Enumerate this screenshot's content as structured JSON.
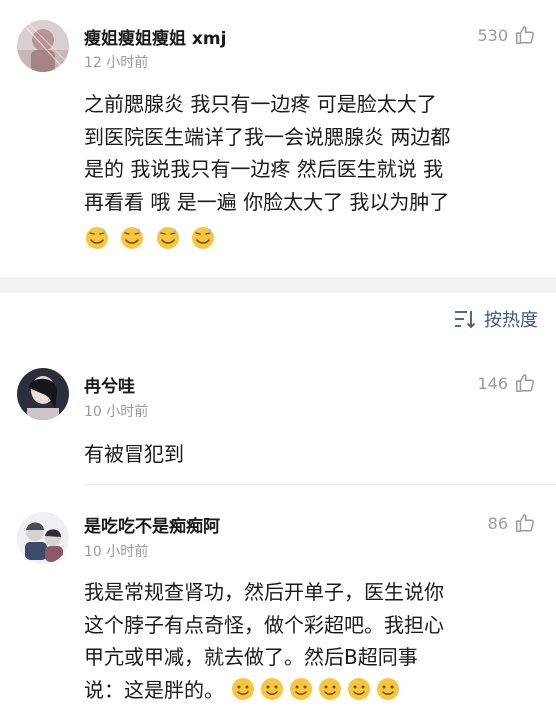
{
  "comments": [
    {
      "username": "瘦姐瘦姐瘦姐 xmj",
      "time": "12 小时前",
      "likes": "530",
      "lines": [
        "之前腮腺炎 我只有一边疼 可是脸太大了",
        "到医院医生端详了我一会说腮腺炎 两边都",
        "是的 我说我只有一边疼 然后医生就说 我",
        "再看看 哦 是一遍 你脸太大了 我以为肿了"
      ],
      "emoji_icon": "sweat-smile-emoji-icon"
    },
    {
      "username": "冉兮哇",
      "time": "10 小时前",
      "likes": "146",
      "lines": [
        "有被冒犯到"
      ]
    },
    {
      "username": "是吃吃不是痴痴阿",
      "time": "10 小时前",
      "likes": "86",
      "lines": [
        "我是常规查肾功，然后开单子，医生说你",
        "这个脖子有点奇怪，做个彩超吧。我担心",
        "甲亢或甲减，就去做了。然后B超同事",
        "说：这是胖的。"
      ],
      "emoji_icon": "slight-smile-emoji-icon"
    }
  ],
  "sort": {
    "label": "按热度",
    "icon": "sort-icon"
  },
  "colors": {
    "link": "#3d5a80",
    "muted": "#9a9a9a",
    "separator": "#f2f2f2"
  }
}
